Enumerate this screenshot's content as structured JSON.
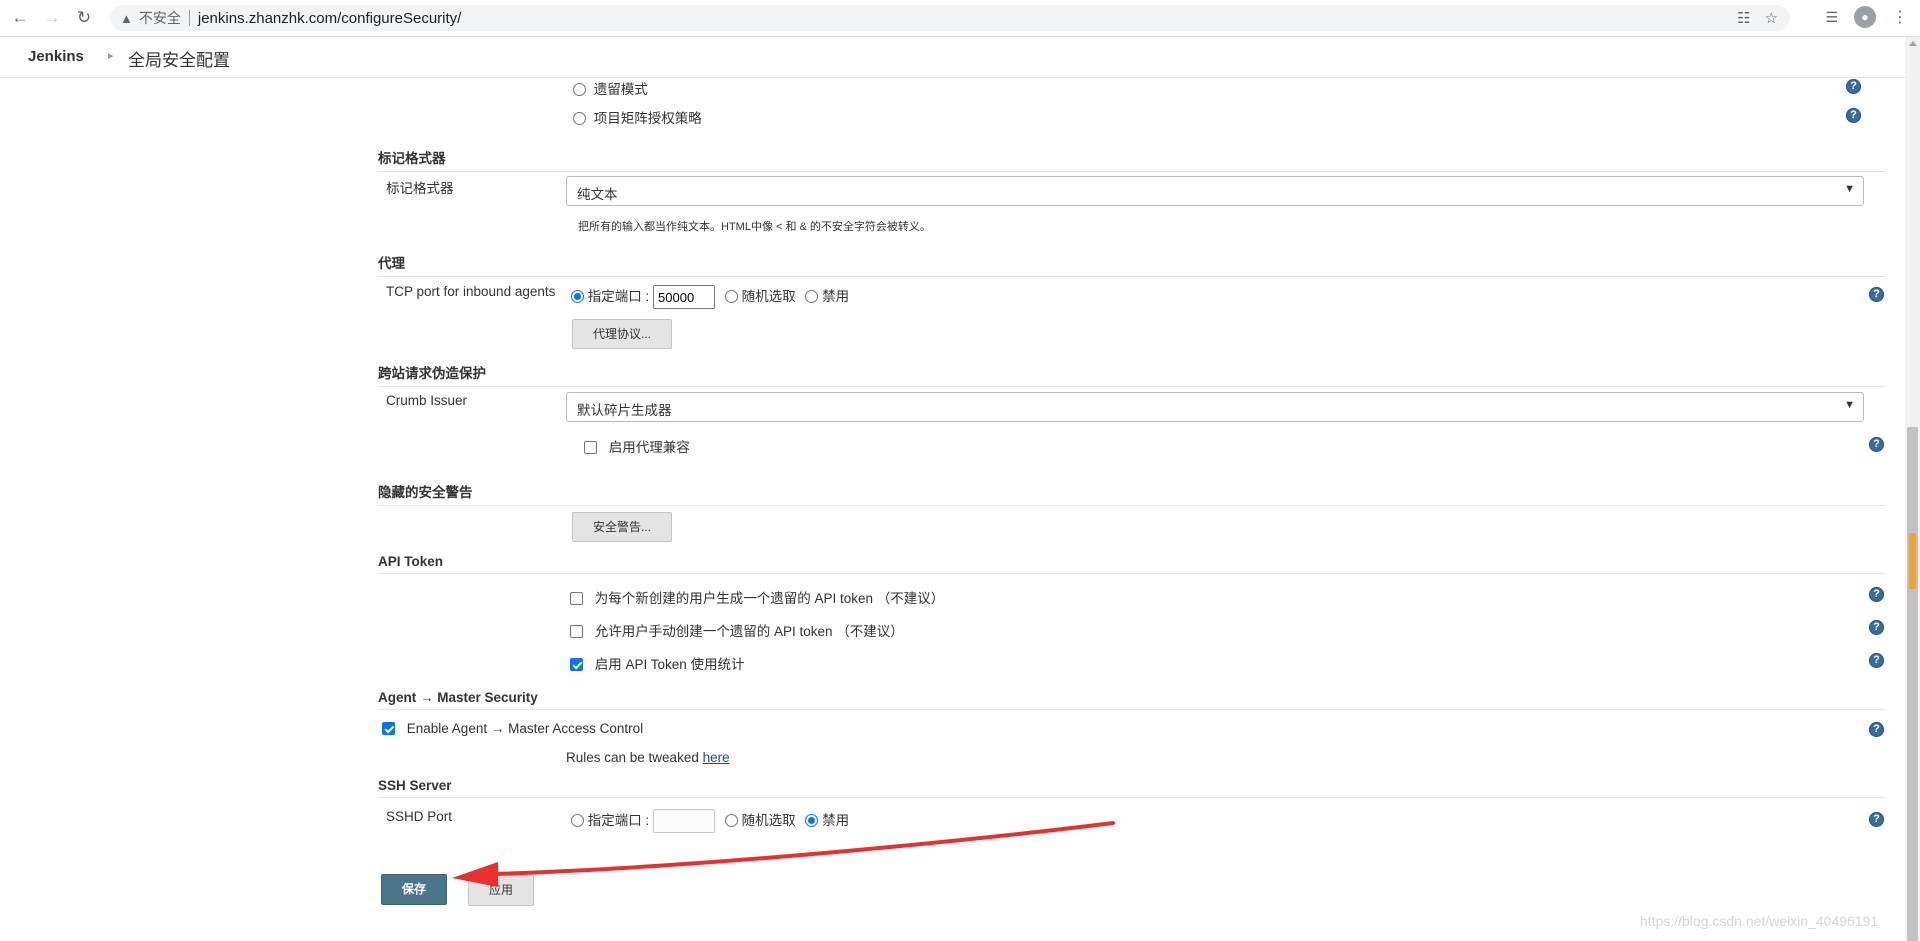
{
  "browser": {
    "insecure_label": "不安全",
    "url": "jenkins.zhanzhk.com/configureSecurity/"
  },
  "breadcrumb": {
    "root": "Jenkins",
    "page": "全局安全配置"
  },
  "authorization": {
    "opt_legacy": "遗留模式",
    "opt_matrix": "项目矩阵授权策略"
  },
  "markup": {
    "section": "标记格式器",
    "label": "标记格式器",
    "selected": "纯文本",
    "description": "把所有的输入都当作纯文本。HTML中像 < 和 & 的不安全字符会被转义。"
  },
  "proxy": {
    "section": "代理",
    "tcp_label": "TCP port for inbound agents",
    "opt_fixed": "指定端口 :",
    "port_value": "50000",
    "opt_random": "随机选取",
    "opt_disable": "禁用",
    "protocols_button": "代理协议..."
  },
  "csrf": {
    "section": "跨站请求伪造保护",
    "label": "Crumb Issuer",
    "selected": "默认碎片生成器",
    "proxy_compat": "启用代理兼容"
  },
  "hidden_warnings": {
    "section": "隐藏的安全警告",
    "button": "安全警告..."
  },
  "api_token": {
    "section": "API Token",
    "opt1": "为每个新创建的用户生成一个遗留的 API token （不建议）",
    "opt2": "允许用户手动创建一个遗留的 API token （不建议）",
    "opt3": "启用 API Token 使用统计"
  },
  "agent_master": {
    "section": "Agent → Master Security",
    "enable": "Enable Agent → Master Access Control",
    "rules_text": "Rules can be tweaked",
    "rules_link": "here"
  },
  "ssh": {
    "section": "SSH Server",
    "label": "SSHD Port",
    "opt_fixed": "指定端口 :",
    "opt_random": "随机选取",
    "opt_disable": "禁用"
  },
  "actions": {
    "save": "保存",
    "apply": "应用"
  },
  "help_symbol": "?",
  "watermark": "https://blog.csdn.net/weixin_40496191",
  "colors": {
    "primary_button": "#4b758b",
    "help_icon": "#3b6aa0",
    "checkbox_accent": "#0075ff",
    "annotation_arrow": "#e8312f"
  }
}
